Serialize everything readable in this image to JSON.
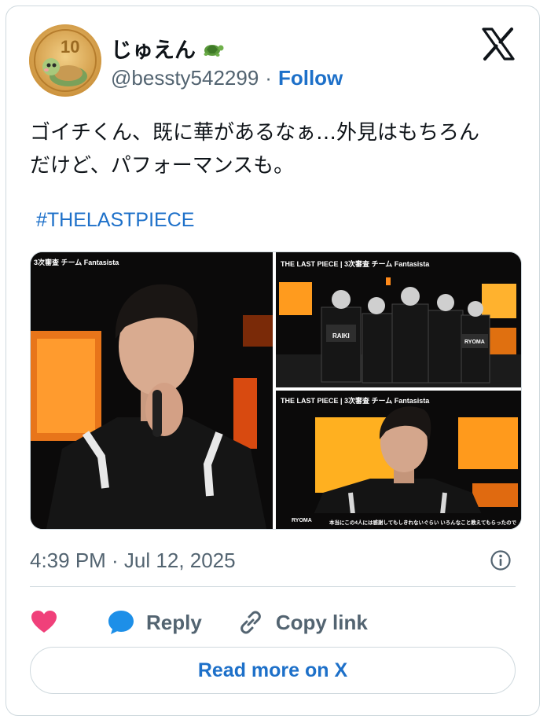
{
  "author": {
    "display_name": "じゅえん",
    "name_emoji": "turtle-icon",
    "handle": "@bessty542299",
    "separator": "·",
    "follow_label": "Follow",
    "avatar_text": "10"
  },
  "platform_logo": "x-logo-icon",
  "tweet": {
    "text_line1": "ゴイチくん、既に華があるなぁ…外見はもちろん",
    "text_line2": "だけど、パフォーマンスも。",
    "hashtag": "#THELASTPIECE"
  },
  "media": {
    "image1_caption": "3次審査 チーム Fantasista",
    "image2_caption": "THE LAST PIECE | 3次審査 チーム Fantasista",
    "image2_jersey1": "RAIKI",
    "image2_jersey2": "RYOMA",
    "image3_caption": "THE LAST PIECE | 3次審査 チーム Fantasista",
    "image3_name": "RYOMA",
    "image3_subtitle": "本当にこの4人には感謝してもしきれないぐらい いろんなこと教えてもらったので"
  },
  "timestamp": "4:39 PM · Jul 12, 2025",
  "actions": {
    "like_icon": "heart-icon",
    "reply_label": "Reply",
    "copy_label": "Copy link"
  },
  "read_more_label": "Read more on X",
  "colors": {
    "accent": "#1d70c9",
    "heart": "#f0407a",
    "muted": "#536471",
    "border": "#cfd9de"
  }
}
